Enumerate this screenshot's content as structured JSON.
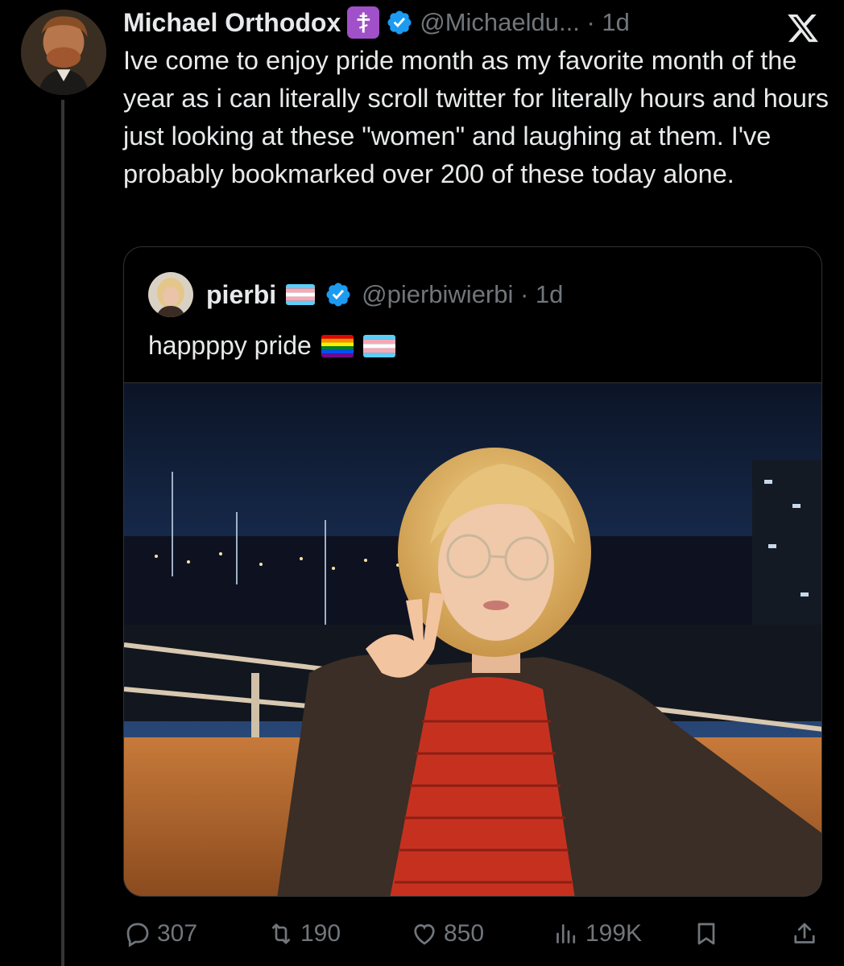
{
  "tweet": {
    "author": {
      "name": "Michael Orthodox",
      "badge_icon": "orthodox-cross-icon",
      "handle_time": "@Michaeldu... · 1d",
      "verified": true
    },
    "text": "Ive come to enjoy pride month as my favorite month of the year as i can literally scroll twitter for literally hours and hours just looking at these \"women\" and laughing at them. I've probably bookmarked over 200 of these today alone.",
    "quote": {
      "author_name": "pierbi",
      "handle_time": "@pierbiwierbi · 1d",
      "text": "happppy pride",
      "flags": [
        "rainbow-flag-icon",
        "transgender-flag-icon"
      ],
      "photo": "selfie at night by the marina"
    },
    "actions": {
      "replies": "307",
      "retweets": "190",
      "likes": "850",
      "views": "199K"
    }
  },
  "colors": {
    "background": "#000000",
    "text": "#e7e9ea",
    "muted": "#71767b",
    "verified": "#1d9bf0",
    "border": "#2f3336",
    "cross_badge": "#a050c8"
  }
}
